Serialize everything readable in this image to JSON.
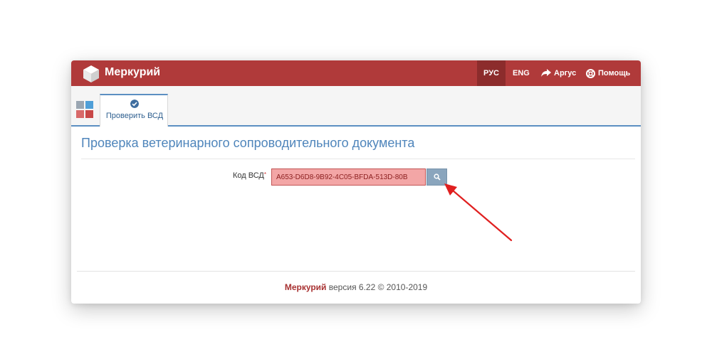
{
  "header": {
    "app_title": "Меркурий",
    "lang_rus": "РУС",
    "lang_eng": "ENG",
    "argus_label": "Аргус",
    "help_label": "Помощь"
  },
  "tabs": {
    "active_label": "Проверить ВСД"
  },
  "main": {
    "heading": "Проверка ветеринарного сопроводительного документа",
    "field_label": "Код ВСД",
    "required_mark": "*",
    "vsd_code_value": "A653-D6D8-9B92-4C05-BFDA-513D-80B"
  },
  "footer": {
    "brand": "Меркурий",
    "version_text": " версия 6.22 © 2010-2019"
  },
  "colors": {
    "header_bg": "#b03a3a",
    "accent_blue": "#5b8fc2",
    "input_error_bg": "#f3a6a6",
    "annotation_arrow": "#e02020"
  },
  "icons": {
    "logo": "cube-logo-icon",
    "argus": "share-arrow-icon",
    "help": "lifebuoy-icon",
    "tab": "check-circle-icon",
    "search": "search-icon"
  }
}
